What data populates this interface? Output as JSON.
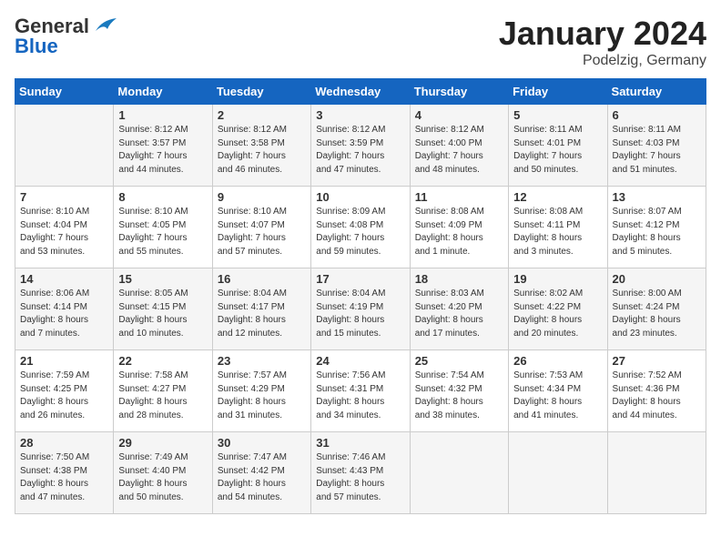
{
  "header": {
    "logo_general": "General",
    "logo_blue": "Blue",
    "month": "January 2024",
    "location": "Podelzig, Germany"
  },
  "days_of_week": [
    "Sunday",
    "Monday",
    "Tuesday",
    "Wednesday",
    "Thursday",
    "Friday",
    "Saturday"
  ],
  "weeks": [
    [
      {
        "day": "",
        "info": ""
      },
      {
        "day": "1",
        "info": "Sunrise: 8:12 AM\nSunset: 3:57 PM\nDaylight: 7 hours\nand 44 minutes."
      },
      {
        "day": "2",
        "info": "Sunrise: 8:12 AM\nSunset: 3:58 PM\nDaylight: 7 hours\nand 46 minutes."
      },
      {
        "day": "3",
        "info": "Sunrise: 8:12 AM\nSunset: 3:59 PM\nDaylight: 7 hours\nand 47 minutes."
      },
      {
        "day": "4",
        "info": "Sunrise: 8:12 AM\nSunset: 4:00 PM\nDaylight: 7 hours\nand 48 minutes."
      },
      {
        "day": "5",
        "info": "Sunrise: 8:11 AM\nSunset: 4:01 PM\nDaylight: 7 hours\nand 50 minutes."
      },
      {
        "day": "6",
        "info": "Sunrise: 8:11 AM\nSunset: 4:03 PM\nDaylight: 7 hours\nand 51 minutes."
      }
    ],
    [
      {
        "day": "7",
        "info": "Sunrise: 8:10 AM\nSunset: 4:04 PM\nDaylight: 7 hours\nand 53 minutes."
      },
      {
        "day": "8",
        "info": "Sunrise: 8:10 AM\nSunset: 4:05 PM\nDaylight: 7 hours\nand 55 minutes."
      },
      {
        "day": "9",
        "info": "Sunrise: 8:10 AM\nSunset: 4:07 PM\nDaylight: 7 hours\nand 57 minutes."
      },
      {
        "day": "10",
        "info": "Sunrise: 8:09 AM\nSunset: 4:08 PM\nDaylight: 7 hours\nand 59 minutes."
      },
      {
        "day": "11",
        "info": "Sunrise: 8:08 AM\nSunset: 4:09 PM\nDaylight: 8 hours\nand 1 minute."
      },
      {
        "day": "12",
        "info": "Sunrise: 8:08 AM\nSunset: 4:11 PM\nDaylight: 8 hours\nand 3 minutes."
      },
      {
        "day": "13",
        "info": "Sunrise: 8:07 AM\nSunset: 4:12 PM\nDaylight: 8 hours\nand 5 minutes."
      }
    ],
    [
      {
        "day": "14",
        "info": "Sunrise: 8:06 AM\nSunset: 4:14 PM\nDaylight: 8 hours\nand 7 minutes."
      },
      {
        "day": "15",
        "info": "Sunrise: 8:05 AM\nSunset: 4:15 PM\nDaylight: 8 hours\nand 10 minutes."
      },
      {
        "day": "16",
        "info": "Sunrise: 8:04 AM\nSunset: 4:17 PM\nDaylight: 8 hours\nand 12 minutes."
      },
      {
        "day": "17",
        "info": "Sunrise: 8:04 AM\nSunset: 4:19 PM\nDaylight: 8 hours\nand 15 minutes."
      },
      {
        "day": "18",
        "info": "Sunrise: 8:03 AM\nSunset: 4:20 PM\nDaylight: 8 hours\nand 17 minutes."
      },
      {
        "day": "19",
        "info": "Sunrise: 8:02 AM\nSunset: 4:22 PM\nDaylight: 8 hours\nand 20 minutes."
      },
      {
        "day": "20",
        "info": "Sunrise: 8:00 AM\nSunset: 4:24 PM\nDaylight: 8 hours\nand 23 minutes."
      }
    ],
    [
      {
        "day": "21",
        "info": "Sunrise: 7:59 AM\nSunset: 4:25 PM\nDaylight: 8 hours\nand 26 minutes."
      },
      {
        "day": "22",
        "info": "Sunrise: 7:58 AM\nSunset: 4:27 PM\nDaylight: 8 hours\nand 28 minutes."
      },
      {
        "day": "23",
        "info": "Sunrise: 7:57 AM\nSunset: 4:29 PM\nDaylight: 8 hours\nand 31 minutes."
      },
      {
        "day": "24",
        "info": "Sunrise: 7:56 AM\nSunset: 4:31 PM\nDaylight: 8 hours\nand 34 minutes."
      },
      {
        "day": "25",
        "info": "Sunrise: 7:54 AM\nSunset: 4:32 PM\nDaylight: 8 hours\nand 38 minutes."
      },
      {
        "day": "26",
        "info": "Sunrise: 7:53 AM\nSunset: 4:34 PM\nDaylight: 8 hours\nand 41 minutes."
      },
      {
        "day": "27",
        "info": "Sunrise: 7:52 AM\nSunset: 4:36 PM\nDaylight: 8 hours\nand 44 minutes."
      }
    ],
    [
      {
        "day": "28",
        "info": "Sunrise: 7:50 AM\nSunset: 4:38 PM\nDaylight: 8 hours\nand 47 minutes."
      },
      {
        "day": "29",
        "info": "Sunrise: 7:49 AM\nSunset: 4:40 PM\nDaylight: 8 hours\nand 50 minutes."
      },
      {
        "day": "30",
        "info": "Sunrise: 7:47 AM\nSunset: 4:42 PM\nDaylight: 8 hours\nand 54 minutes."
      },
      {
        "day": "31",
        "info": "Sunrise: 7:46 AM\nSunset: 4:43 PM\nDaylight: 8 hours\nand 57 minutes."
      },
      {
        "day": "",
        "info": ""
      },
      {
        "day": "",
        "info": ""
      },
      {
        "day": "",
        "info": ""
      }
    ]
  ]
}
